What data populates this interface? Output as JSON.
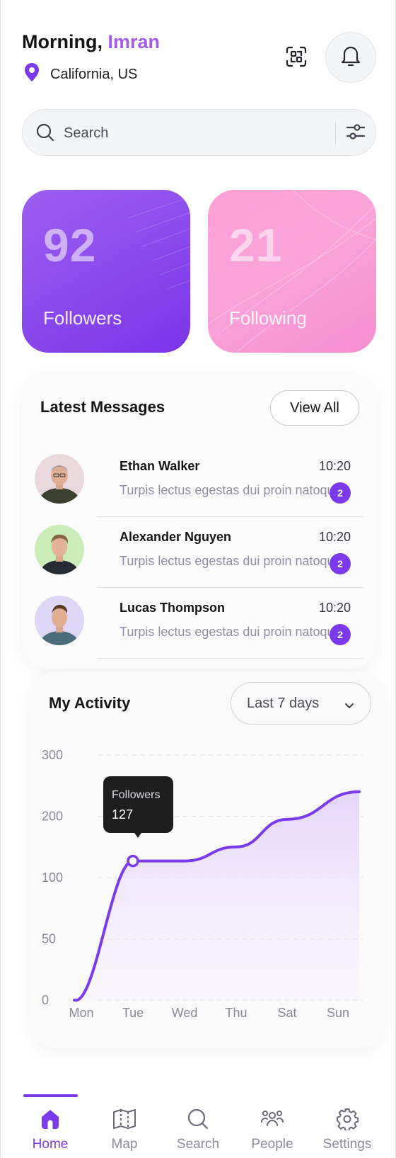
{
  "header": {
    "greeting": "Morning,",
    "user_name": "Imran",
    "location": "California, US",
    "icons": {
      "location": "map-pin-icon",
      "qr": "qr-scan-icon",
      "notifications": "bell-icon"
    }
  },
  "search": {
    "placeholder": "Search",
    "icons": {
      "search": "search-icon",
      "filter": "sliders-icon"
    }
  },
  "stats": {
    "followers": {
      "value": "92",
      "label": "Followers"
    },
    "following": {
      "value": "21",
      "label": "Following"
    }
  },
  "messages": {
    "title": "Latest Messages",
    "view_all": "View All",
    "items": [
      {
        "name": "Ethan Walker",
        "preview": "Turpis lectus egestas dui proin natoque",
        "time": "10:20",
        "unread": "2"
      },
      {
        "name": "Alexander Nguyen",
        "preview": "Turpis lectus egestas dui proin natoque",
        "time": "10:20",
        "unread": "2"
      },
      {
        "name": "Lucas Thompson",
        "preview": "Turpis lectus egestas dui proin natoque",
        "time": "10:20",
        "unread": "2"
      }
    ]
  },
  "activity": {
    "title": "My Activity",
    "range": "Last 7 days",
    "tooltip": {
      "label": "Followers",
      "value": "127"
    }
  },
  "chart_data": {
    "type": "area",
    "categories": [
      "Mon",
      "Tue",
      "Wed",
      "Thu",
      "Sat",
      "Sun"
    ],
    "y_ticks": [
      "300",
      "200",
      "100",
      "50",
      "0"
    ],
    "series": [
      {
        "values": [
          0,
          127,
          127,
          150,
          195,
          240
        ]
      }
    ],
    "highlight_index": 1,
    "grid": "dashed horizontal",
    "colors": {
      "line": "#7c3aed",
      "fill_top": "#e4d4fb"
    }
  },
  "nav": {
    "items": [
      {
        "label": "Home",
        "icon": "home-icon",
        "active": true
      },
      {
        "label": "Map",
        "icon": "map-icon",
        "active": false
      },
      {
        "label": "Search",
        "icon": "search-icon",
        "active": false
      },
      {
        "label": "People",
        "icon": "people-icon",
        "active": false
      },
      {
        "label": "Settings",
        "icon": "gear-icon",
        "active": false
      }
    ]
  },
  "colors": {
    "accent": "#7c3aed",
    "name_accent": "#a35ce8",
    "followers_card": "#8a4bee",
    "following_card": "#fba3da"
  }
}
